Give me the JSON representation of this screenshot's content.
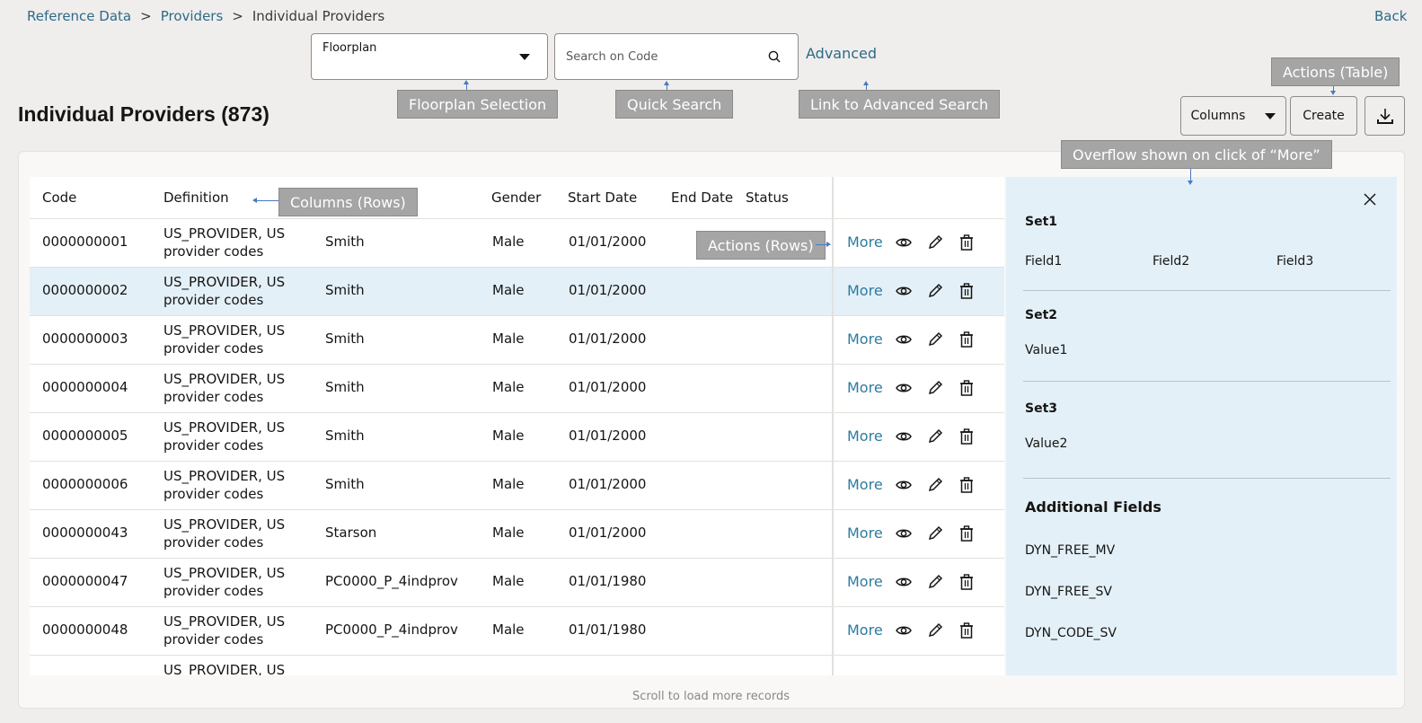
{
  "breadcrumb": {
    "items": [
      {
        "label": "Reference Data",
        "link": true
      },
      {
        "label": "Providers",
        "link": true
      },
      {
        "label": "Individual Providers",
        "link": false
      }
    ],
    "separator": ">"
  },
  "header": {
    "back_label": "Back",
    "title": "Individual Providers (873)"
  },
  "filters": {
    "floorplan": {
      "value": "Floorplan",
      "icon": "caret-down-icon"
    },
    "search": {
      "placeholder": "Search on Code",
      "value": "",
      "icon": "search-icon"
    },
    "advanced_label": "Advanced"
  },
  "toolbar": {
    "columns_label": "Columns",
    "create_label": "Create",
    "download_icon": "download-icon"
  },
  "annotations": {
    "floorplan_selection": "Floorplan Selection",
    "quick_search": "Quick Search",
    "advanced_search": "Link to Advanced Search",
    "actions_table": "Actions (Table)",
    "overflow": "Overflow shown on click of “More”",
    "columns_rows": "Columns (Rows)",
    "actions_rows": "Actions (Rows)"
  },
  "table": {
    "columns": [
      "Code",
      "Definition",
      "",
      "Gender",
      "Start Date",
      "End Date",
      "Status"
    ],
    "more_label": "More",
    "row_icons": [
      "view-icon",
      "edit-icon",
      "delete-icon"
    ],
    "rows": [
      {
        "code": "0000000001",
        "definition_1": "US_PROVIDER, US",
        "definition_2": "provider codes",
        "name": "Smith",
        "gender": "Male",
        "start_date": "01/01/2000",
        "end_date": "",
        "status": "",
        "selected": false
      },
      {
        "code": "0000000002",
        "definition_1": "US_PROVIDER, US",
        "definition_2": "provider codes",
        "name": "Smith",
        "gender": "Male",
        "start_date": "01/01/2000",
        "end_date": "",
        "status": "",
        "selected": true
      },
      {
        "code": "0000000003",
        "definition_1": "US_PROVIDER, US",
        "definition_2": "provider codes",
        "name": "Smith",
        "gender": "Male",
        "start_date": "01/01/2000",
        "end_date": "",
        "status": "",
        "selected": false
      },
      {
        "code": "0000000004",
        "definition_1": "US_PROVIDER, US",
        "definition_2": "provider codes",
        "name": "Smith",
        "gender": "Male",
        "start_date": "01/01/2000",
        "end_date": "",
        "status": "",
        "selected": false
      },
      {
        "code": "0000000005",
        "definition_1": "US_PROVIDER, US",
        "definition_2": "provider codes",
        "name": "Smith",
        "gender": "Male",
        "start_date": "01/01/2000",
        "end_date": "",
        "status": "",
        "selected": false
      },
      {
        "code": "0000000006",
        "definition_1": "US_PROVIDER, US",
        "definition_2": "provider codes",
        "name": "Smith",
        "gender": "Male",
        "start_date": "01/01/2000",
        "end_date": "",
        "status": "",
        "selected": false
      },
      {
        "code": "0000000043",
        "definition_1": "US_PROVIDER, US",
        "definition_2": "provider codes",
        "name": "Starson",
        "gender": "Male",
        "start_date": "01/01/2000",
        "end_date": "",
        "status": "",
        "selected": false
      },
      {
        "code": "0000000047",
        "definition_1": "US_PROVIDER, US",
        "definition_2": "provider codes",
        "name": "PC0000_P_4indprov",
        "gender": "Male",
        "start_date": "01/01/1980",
        "end_date": "",
        "status": "",
        "selected": false
      },
      {
        "code": "0000000048",
        "definition_1": "US_PROVIDER, US",
        "definition_2": "provider codes",
        "name": "PC0000_P_4indprov",
        "gender": "Male",
        "start_date": "01/01/1980",
        "end_date": "",
        "status": "",
        "selected": false
      },
      {
        "code": "",
        "definition_1": "US_PROVIDER, US",
        "definition_2": "",
        "name": "",
        "gender": "",
        "start_date": "",
        "end_date": "",
        "status": "",
        "selected": false
      }
    ],
    "footer_hint": "Scroll to load more records"
  },
  "overflow_panel": {
    "close_icon": "close-icon",
    "sets": [
      {
        "title": "Set1",
        "values": [
          "Field1",
          "Field2",
          "Field3"
        ]
      },
      {
        "title": "Set2",
        "values": [
          "Value1"
        ]
      },
      {
        "title": "Set3",
        "values": [
          "Value2"
        ]
      }
    ],
    "additional_title": "Additional Fields",
    "additional_fields": [
      "DYN_FREE_MV",
      "DYN_FREE_SV",
      "DYN_CODE_SV"
    ]
  },
  "colors": {
    "link": "#2c6a88",
    "selected_row": "#e4f0f7",
    "annotation_bg": "#a5a5a5",
    "annotation_arrow": "#4a78c2"
  }
}
